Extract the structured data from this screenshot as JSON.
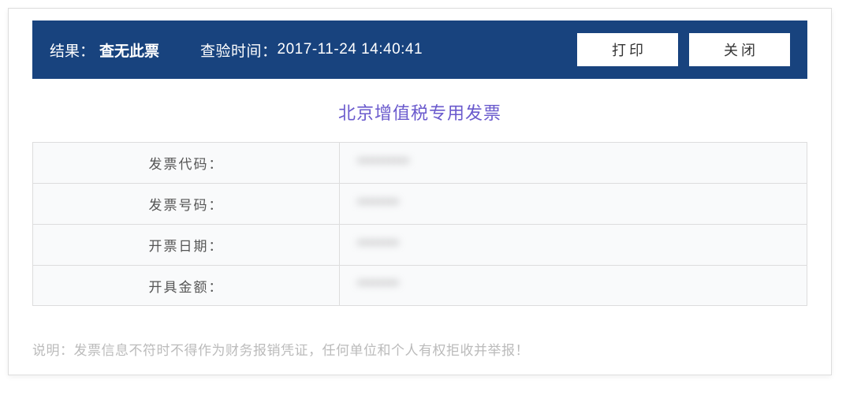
{
  "header": {
    "result_label": "结果：",
    "result_value": "查无此票",
    "time_label": "查验时间：",
    "time_value": "2017-11-24 14:40:41",
    "print_label": "打印",
    "close_label": "关闭"
  },
  "title": "北京增值税专用发票",
  "fields": [
    {
      "label": "发票代码：",
      "value": "**********"
    },
    {
      "label": "发票号码：",
      "value": "********"
    },
    {
      "label": "开票日期：",
      "value": "********"
    },
    {
      "label": "开具金额：",
      "value": "********"
    }
  ],
  "notice": "说明：发票信息不符时不得作为财务报销凭证，任何单位和个人有权拒收并举报！"
}
